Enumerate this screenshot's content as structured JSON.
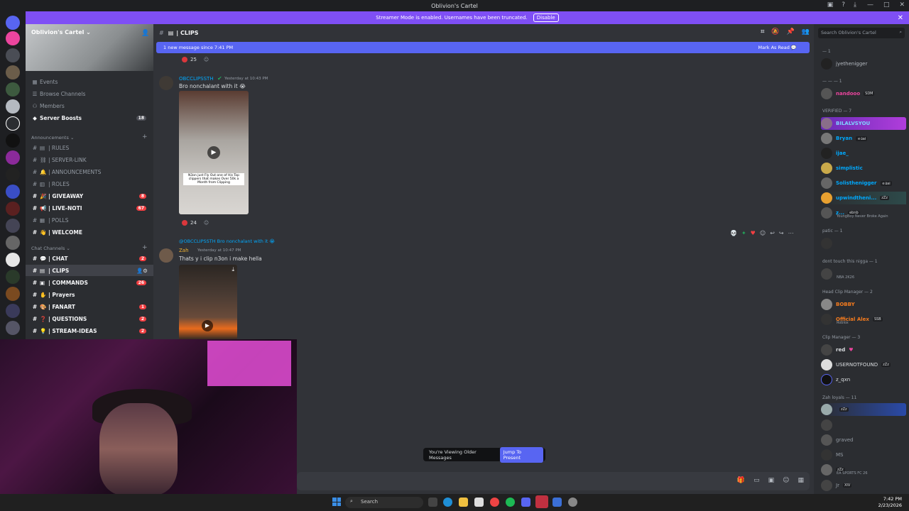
{
  "window": {
    "title": "Oblivion's Cartel"
  },
  "banner": {
    "text": "Streamer Mode is enabled. Usernames have been truncated.",
    "button": "Disable"
  },
  "server": {
    "name": "Oblivion's Cartel",
    "nav": [
      {
        "label": "Events",
        "icon": "calendar-icon"
      },
      {
        "label": "Browse Channels",
        "icon": "list-icon"
      },
      {
        "label": "Members",
        "icon": "members-icon"
      },
      {
        "label": "Server Boosts",
        "icon": "boost-icon",
        "count": "18"
      }
    ],
    "categories": [
      {
        "name": "Announcements",
        "channels": [
          {
            "label": "| RULES",
            "bold": false
          },
          {
            "label": "| SERVER-LINK",
            "bold": false
          },
          {
            "label": "| ANNOUNCEMENTS",
            "bold": false
          },
          {
            "label": "| ROLES",
            "bold": false
          },
          {
            "label": "| GIVEAWAY",
            "bold": true,
            "badge": "8"
          },
          {
            "label": "| LIVE-NOTI",
            "bold": true,
            "badge": "67"
          },
          {
            "label": "| POLLS",
            "bold": false
          },
          {
            "label": "| WELCOME",
            "bold": true
          }
        ]
      },
      {
        "name": "Chat Channels",
        "channels": [
          {
            "label": "| CHAT",
            "bold": true,
            "badge": "2"
          },
          {
            "label": "| CLIPS",
            "bold": true,
            "active": true
          },
          {
            "label": "| COMMANDS",
            "bold": true,
            "badge": "26"
          },
          {
            "label": "| Prayers",
            "bold": true
          },
          {
            "label": "| FANART",
            "bold": true,
            "badge": "1"
          },
          {
            "label": "| QUESTIONS",
            "bold": true,
            "badge": "2"
          },
          {
            "label": "| STREAM-IDEAS",
            "bold": true,
            "badge": "2"
          }
        ]
      }
    ]
  },
  "channel": {
    "name": "| CLIPS",
    "new_message_bar": "1 new message since 7:41 PM",
    "mark_as_read": "Mark As Read",
    "reaction_top": "25",
    "messages": [
      {
        "author": "OBCCLIPSSTH",
        "timestamp": "Yesterday at 10:43 PM",
        "text": "Bro nonchalant with it 😭",
        "clip_caption": "N3on just Fly Out one of His Top clippers that makes Over 50k a Month from Clipping",
        "reaction": "24"
      },
      {
        "reply_to": "@OBCCLIPSSTH Bro nonchalant with it 😭",
        "author": "Zah",
        "timestamp": "Yesterday at 10:47 PM",
        "text": "Thats y i clip n3on i make hella"
      }
    ],
    "older_notice": "You're Viewing Older Messages",
    "jump_button": "Jump To Present"
  },
  "members": {
    "search_placeholder": "Search Oblivion's Cartel",
    "groups": [
      {
        "title": "— 1",
        "members": [
          {
            "name": "jyethenigger",
            "color": "#b5bac1"
          }
        ]
      },
      {
        "title": "— — — 1",
        "members": [
          {
            "name": "nandooo",
            "color": "#eb459e",
            "tag": "SDM"
          }
        ]
      },
      {
        "title": "VERIFIED — 7",
        "members": [
          {
            "name": "BILALVSYOU",
            "color": "#00a8fc",
            "highlight": true
          },
          {
            "name": "Bryan",
            "color": "#00a8fc",
            "tag": "ｅ۵ai"
          },
          {
            "name": "ijae_",
            "color": "#00a8fc"
          },
          {
            "name": "simplistic",
            "color": "#00a8fc"
          },
          {
            "name": "Solisthenigger",
            "color": "#00a8fc",
            "tag": "ｅ۵ai"
          },
          {
            "name": "upwindtheni...",
            "color": "#00a8fc",
            "tag": "zZz"
          },
          {
            "name": "z...",
            "color": "#00a8fc",
            "tag": "ebnb",
            "sub": "YoungBoy Never Broke Again"
          }
        ]
      },
      {
        "title": "patic — 1",
        "members": [
          {
            "name": "",
            "color": "#b5bac1"
          }
        ]
      },
      {
        "title": "dont touch this nigga — 1",
        "members": [
          {
            "name": "",
            "color": "#b5bac1",
            "sub": "NBA 2K26"
          }
        ]
      },
      {
        "title": "Head Clip Manager — 2",
        "members": [
          {
            "name": "BOBBY",
            "color": "#f47b1e"
          },
          {
            "name": "Official Alex",
            "color": "#f47b1e",
            "tag": "SSB",
            "sub": "Roblox"
          }
        ]
      },
      {
        "title": "Clip Manager — 3",
        "members": [
          {
            "name": "red",
            "color": "#dbdee1"
          },
          {
            "name": "USERNOTFOUND",
            "color": "#dbdee1",
            "tag": "zZz"
          },
          {
            "name": "z_qxn",
            "color": "#dbdee1"
          }
        ]
      },
      {
        "title": "Zah loyals — 11",
        "members": [
          {
            "name": "",
            "color": "#dbdee1",
            "tag": "zZz",
            "highlight": true
          },
          {
            "name": "",
            "color": "#949ba4"
          },
          {
            "name": "graved",
            "color": "#949ba4"
          },
          {
            "name": "MS",
            "color": "#949ba4"
          },
          {
            "name": "",
            "color": "#dbdee1",
            "tag": "zZz",
            "sub": "EA SPORTS FC 26"
          },
          {
            "name": "Jr",
            "color": "#949ba4",
            "tag": "XIV"
          }
        ]
      }
    ]
  },
  "taskbar": {
    "search": "Search",
    "time": "7:42 PM",
    "date": "2/23/2026"
  }
}
